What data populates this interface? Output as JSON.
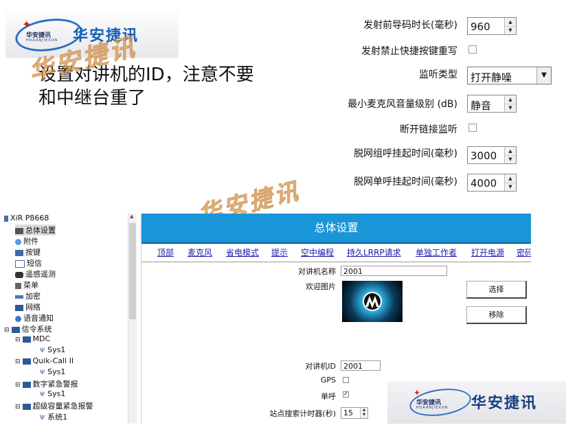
{
  "headline": {
    "line1": "设置对讲机的ID，注意不要",
    "line2": "和中继台重了"
  },
  "logo": {
    "brand_cn": "华安捷讯",
    "brand_small": "华安捷讯",
    "brand_pinyin": "HUAANJIEXUN"
  },
  "watermark": "华安捷讯",
  "top_settings": {
    "preamble_label": "发射前导码时长(毫秒)",
    "preamble_value": "960",
    "tx_inhibit_label": "发射禁止快捷按键重写",
    "monitor_type_label": "监听类型",
    "monitor_type_value": "打开静噪",
    "min_volume_label": "最小麦克风音量级别 (dB)",
    "min_volume_value": "静音",
    "open_monitor_label": "断开链接监听",
    "group_hang_label": "脱网组呼挂起时间(毫秒)",
    "group_hang_value": "3000",
    "private_hang_label": "脱网单呼挂起时间(毫秒)",
    "private_hang_value": "4000"
  },
  "tree": {
    "root": "XiR P8668",
    "items": [
      "总体设置",
      "附件",
      "按键",
      "短信",
      "遥感遥测",
      "菜单",
      "加密",
      "网络",
      "语音通知",
      "信令系统",
      "MDC",
      "Sys1",
      "Quik-Call II",
      "Sys1",
      "数字紧急警报",
      "Sys1",
      "超级容量紧急报警",
      "系统1"
    ]
  },
  "main": {
    "title": "总体设置",
    "nav": [
      "顶部",
      "麦克风",
      "省电模式",
      "提示",
      "空中编程",
      "持久LRRP请求",
      "单独工作者",
      "打开电源",
      "密码"
    ],
    "radio_name_label": "对讲机名称",
    "radio_name_value": "2001",
    "welcome_image_label": "欢迎图片",
    "select_button": "选择",
    "remove_button": "移除",
    "radio_id_label": "对讲机ID",
    "radio_id_value": "2001",
    "gps_label": "GPS",
    "single_call_label": "单呼",
    "single_call_check": "✓",
    "site_search_label": "站点搜索计时器(秒)",
    "site_search_value": "15"
  }
}
